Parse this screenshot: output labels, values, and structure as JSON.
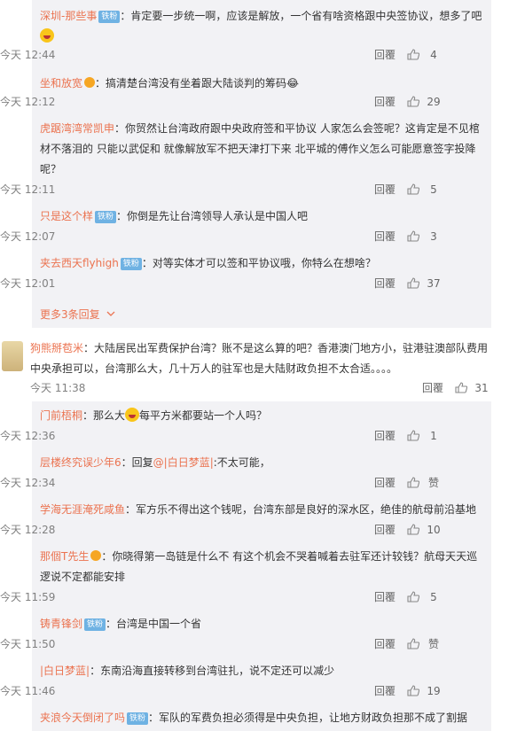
{
  "comments": [
    {
      "user": "深圳-那些事",
      "badge": "铁粉",
      "text_before": "：肯定要一步统一啊，应该是解放，一个省有啥资格跟中央签协议，想多了吧",
      "time": "今天 12:44",
      "reply": "回覆",
      "likes": "4"
    },
    {
      "user": "坐和放宽",
      "text": "：搞清楚台湾没有坐着跟大陆谈判的筹码😂",
      "time": "今天 12:12",
      "reply": "回覆",
      "likes": "29"
    },
    {
      "user": "虎踞湾湾常凯申",
      "text": "：你贸然让台湾政府跟中央政府签和平协议 人家怎么会签呢？这肯定是不见棺材不落泪的 只能以武促和 就像解放军不把天津打下来 北平城的傅作义怎么可能愿意签字投降呢？",
      "time": "今天 12:11",
      "reply": "回覆",
      "likes": "5"
    },
    {
      "user": "只是这个样",
      "badge": "铁粉",
      "text": "：你倒是先让台湾领导人承认是中国人吧",
      "time": "今天 12:07",
      "reply": "回覆",
      "likes": "3"
    },
    {
      "user": "夹去西天flyhigh",
      "badge": "铁粉",
      "text": "：对等实体才可以签和平协议哦，你特么在想啥？",
      "time": "今天 12:01",
      "reply": "回覆",
      "likes": "37"
    }
  ],
  "more_replies": "更多3条回复",
  "main_comment": {
    "user": "狗熊掰苞米",
    "text": "：大陆居民出军费保护台湾？账不是这么算的吧？香港澳门地方小，驻港驻澳部队费用中央承担可以，台湾那么大，几十万人的驻军也是大陆财政负担不太合适。。。。",
    "time": "今天 11:38",
    "reply": "回覆",
    "likes": "31"
  },
  "replies": [
    {
      "user": "门前梧桐",
      "text_before": "：那么大",
      "text_after": "每平方米都要站一个人吗？",
      "time": "今天 12:36",
      "reply": "回覆",
      "likes": "1"
    },
    {
      "user": "层楼终究误少年6",
      "text_pre": "：回复",
      "mention": "@|白日梦蓝|",
      "text_post": ":不太可能，",
      "time": "今天 12:34",
      "reply": "回覆",
      "likes": "赞"
    },
    {
      "user": "学海无涯淹死咸鱼",
      "text": "：军方乐不得出这个钱呢，台湾东部是良好的深水区，绝佳的航母前沿基地",
      "time": "今天 12:28",
      "reply": "回覆",
      "likes": "10"
    },
    {
      "user": "那個T先生",
      "text": "：你晓得第一岛链是什么不 有这个机会不哭着喊着去驻军还计较钱？航母天天巡逻说不定都能安排",
      "time": "今天 11:59",
      "reply": "回覆",
      "likes": "5"
    },
    {
      "user": "铸青锋剑",
      "badge": "铁粉",
      "text": "：台湾是中国一个省",
      "time": "今天 11:50",
      "reply": "回覆",
      "likes": "赞"
    },
    {
      "user": "|白日梦蓝|",
      "text": "：东南沿海直接转移到台湾驻扎，说不定还可以减少",
      "time": "今天 11:46",
      "reply": "回覆",
      "likes": "19"
    },
    {
      "user": "夹浪今天倒闭了吗",
      "badge": "铁粉",
      "text": "：军队的军费负担必须得是中央负担，让地方财政负担那不成了割据"
    }
  ]
}
